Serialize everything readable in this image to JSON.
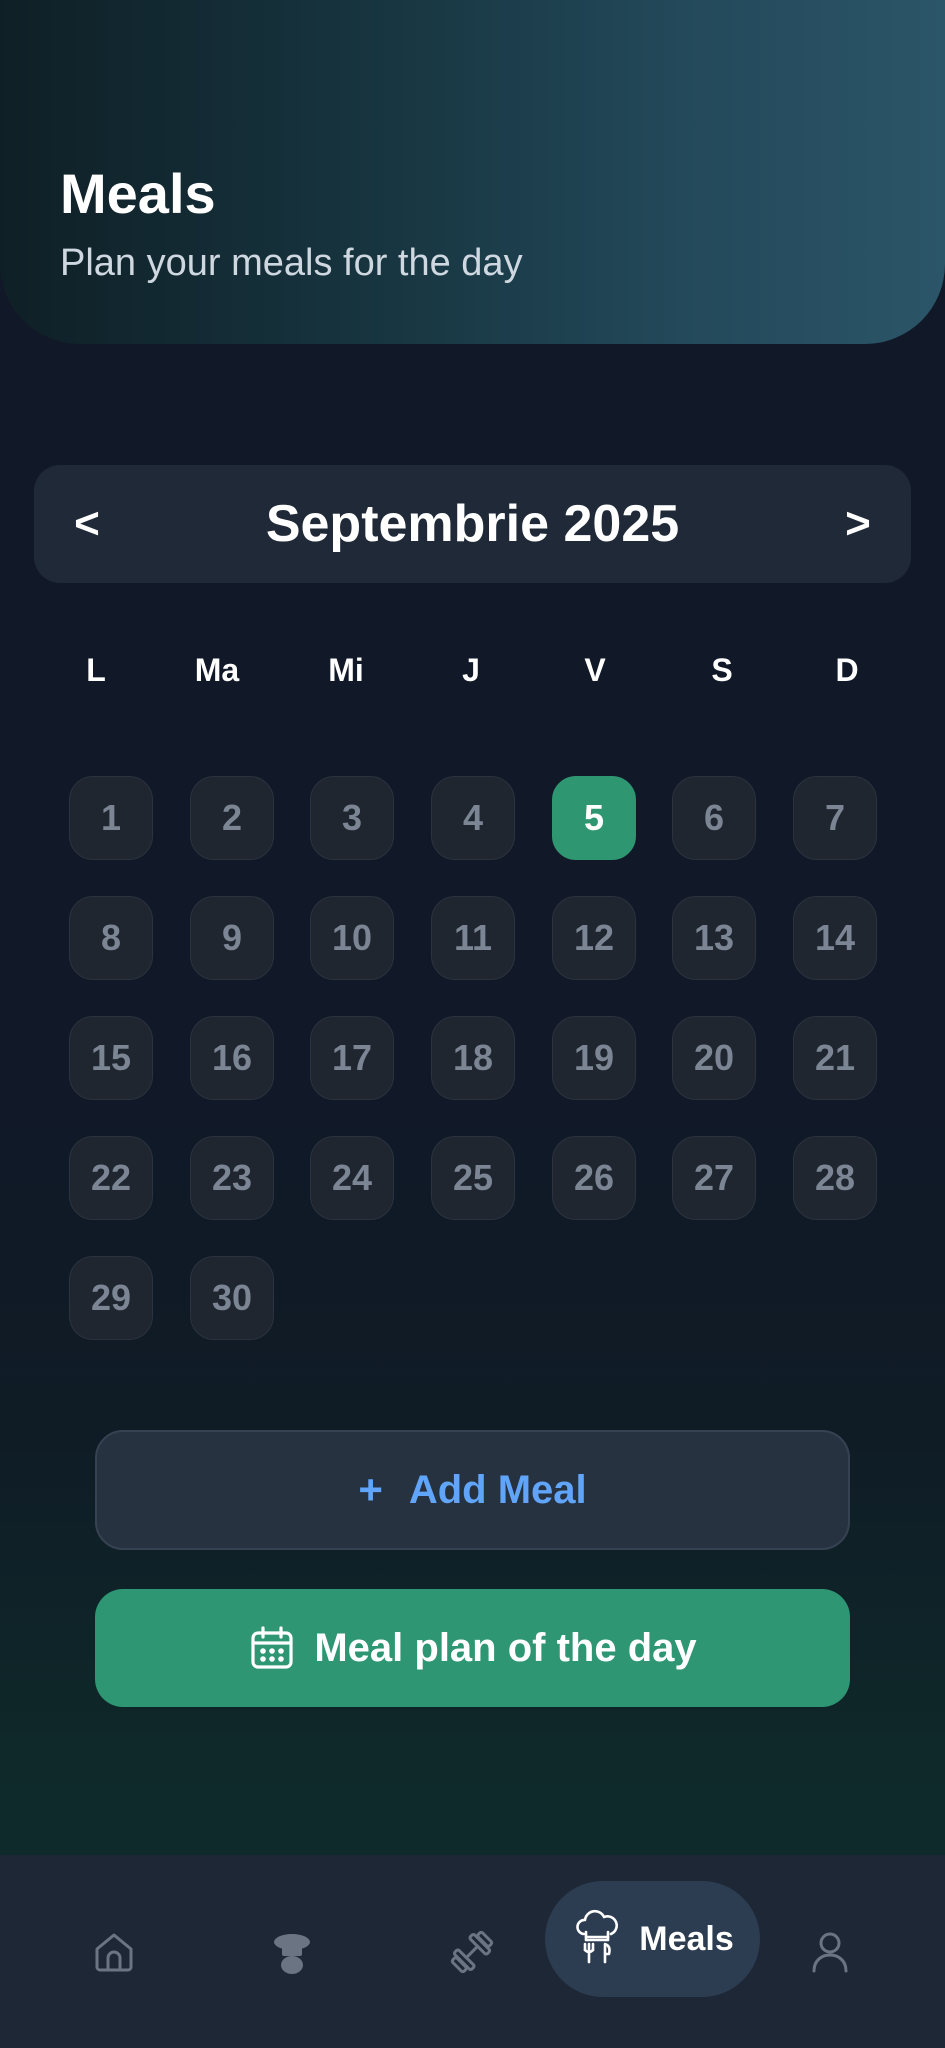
{
  "header": {
    "title": "Meals",
    "subtitle": "Plan your meals for the day"
  },
  "calendar": {
    "month_label": "Septembrie 2025",
    "prev_label": "<",
    "next_label": ">",
    "weekdays": [
      "L",
      "Ma",
      "Mi",
      "J",
      "V",
      "S",
      "D"
    ],
    "days": [
      "1",
      "2",
      "3",
      "4",
      "5",
      "6",
      "7",
      "8",
      "9",
      "10",
      "11",
      "12",
      "13",
      "14",
      "15",
      "16",
      "17",
      "18",
      "19",
      "20",
      "21",
      "22",
      "23",
      "24",
      "25",
      "26",
      "27",
      "28",
      "29",
      "30"
    ],
    "selected_day": "5"
  },
  "actions": {
    "add_meal_plus": "+",
    "add_meal_label": "Add Meal",
    "meal_plan_label": "Meal plan of the day"
  },
  "bottom_nav": {
    "items": [
      {
        "icon": "home-icon"
      },
      {
        "icon": "chef-hat-icon"
      },
      {
        "icon": "dumbbell-icon"
      },
      {
        "icon": "chef-hat-utensils-icon",
        "label": "Meals",
        "active": true
      },
      {
        "icon": "user-icon"
      }
    ]
  },
  "colors": {
    "accent_green": "#2e9672",
    "link_blue": "#60a5fa",
    "background": "#111827"
  }
}
